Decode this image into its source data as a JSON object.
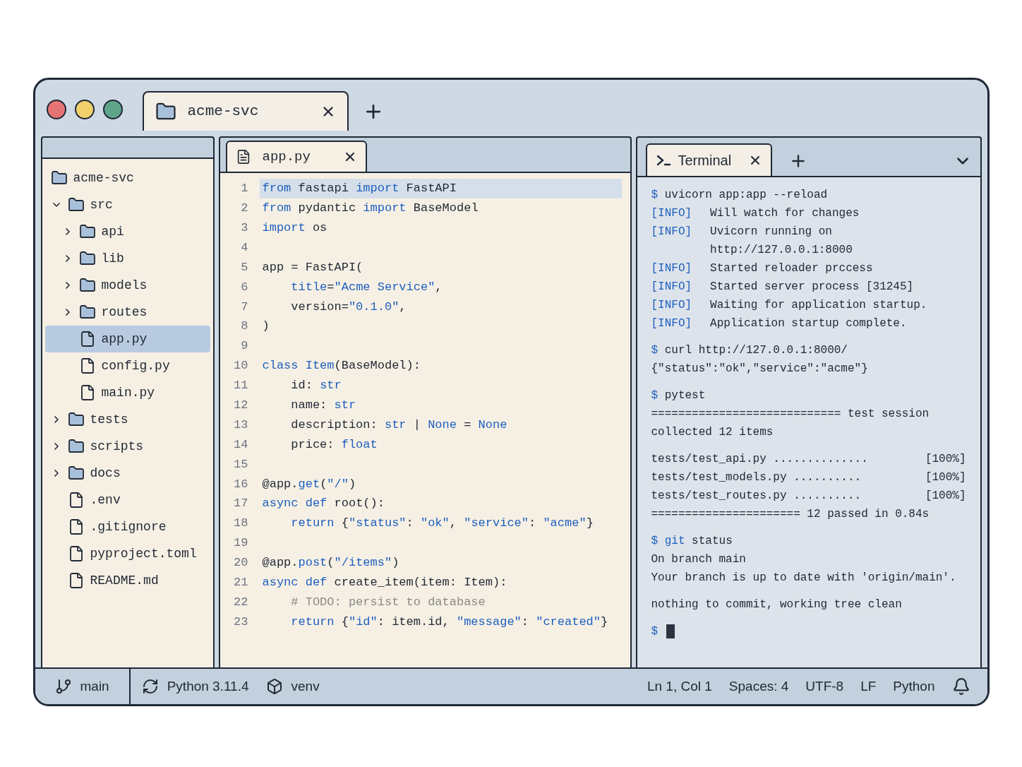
{
  "window": {
    "controls": [
      {
        "color": "#e57373"
      },
      {
        "color": "#f2d06b"
      },
      {
        "color": "#5fa58a"
      }
    ],
    "tabs": [
      {
        "label": "acme-svc",
        "selected": true
      }
    ]
  },
  "sidebar": {
    "tree": [
      {
        "label": "acme-svc",
        "kind": "folder",
        "selected": false,
        "children": [
          {
            "label": "src",
            "kind": "folder",
            "expanded": true,
            "selected": false,
            "children": [
              {
                "label": "api",
                "kind": "folder",
                "expanded": false,
                "selected": false
              },
              {
                "label": "lib",
                "kind": "folder",
                "expanded": false,
                "selected": false
              },
              {
                "label": "models",
                "kind": "folder",
                "expanded": false,
                "selected": false
              },
              {
                "label": "routes",
                "kind": "folder",
                "expanded": false,
                "selected": false
              },
              {
                "label": "app.py",
                "kind": "file",
                "selected": true
              },
              {
                "label": "config.py",
                "kind": "file",
                "selected": false
              },
              {
                "label": "main.py",
                "kind": "file",
                "selected": false
              }
            ]
          },
          {
            "label": "tests",
            "kind": "folder",
            "expanded": false,
            "selected": false
          },
          {
            "label": "scripts",
            "kind": "folder",
            "expanded": false,
            "selected": false
          },
          {
            "label": "docs",
            "kind": "folder",
            "expanded": false,
            "selected": false
          },
          {
            "label": ".env",
            "kind": "file",
            "selected": false
          },
          {
            "label": ".gitignore",
            "kind": "file",
            "selected": false
          },
          {
            "label": "pyproject.toml",
            "kind": "file",
            "selected": false
          },
          {
            "label": "README.md",
            "kind": "file",
            "selected": false
          }
        ]
      }
    ]
  },
  "editor": {
    "tabs": [
      {
        "label": "app.py",
        "selected": true
      }
    ],
    "lines": [
      {
        "number": "1",
        "highlighted": true,
        "segments": [
          {
            "kind": "keyword",
            "text": "from"
          },
          {
            "kind": "text",
            "text": " fastapi "
          },
          {
            "kind": "keyword",
            "text": "import"
          },
          {
            "kind": "text",
            "text": " FastAPI"
          }
        ]
      },
      {
        "number": "2",
        "highlighted": false,
        "segments": [
          {
            "kind": "keyword",
            "text": "from"
          },
          {
            "kind": "text",
            "text": " pydantic "
          },
          {
            "kind": "keyword",
            "text": "import"
          },
          {
            "kind": "text",
            "text": " BaseModel"
          }
        ]
      },
      {
        "number": "3",
        "highlighted": false,
        "segments": [
          {
            "kind": "keyword",
            "text": "import"
          },
          {
            "kind": "text",
            "text": " os"
          }
        ]
      },
      {
        "number": "4",
        "highlighted": false
      },
      {
        "number": "5",
        "highlighted": false,
        "segments": [
          {
            "kind": "text",
            "text": "app = FastAPI("
          }
        ]
      },
      {
        "number": "6",
        "highlighted": false,
        "segments": [
          {
            "kind": "keyword",
            "text": "    title"
          },
          {
            "kind": "text",
            "text": "="
          },
          {
            "kind": "keyword",
            "text": "\"Acme Service\""
          },
          {
            "kind": "text",
            "text": ","
          }
        ]
      },
      {
        "number": "7",
        "highlighted": false,
        "segments": [
          {
            "kind": "text",
            "text": "    version="
          },
          {
            "kind": "keyword",
            "text": "\"0.1.0\""
          },
          {
            "kind": "text",
            "text": ","
          }
        ]
      },
      {
        "number": "8",
        "highlighted": false,
        "segments": [
          {
            "kind": "text",
            "text": ")"
          }
        ]
      },
      {
        "number": "9",
        "highlighted": false
      },
      {
        "number": "10",
        "highlighted": false,
        "segments": [
          {
            "kind": "keyword",
            "text": "class Item"
          },
          {
            "kind": "text",
            "text": "(BaseModel):"
          }
        ]
      },
      {
        "number": "11",
        "highlighted": false,
        "segments": [
          {
            "kind": "text",
            "text": "    id: "
          },
          {
            "kind": "keyword",
            "text": "str"
          }
        ]
      },
      {
        "number": "12",
        "highlighted": false,
        "segments": [
          {
            "kind": "text",
            "text": "    name: "
          },
          {
            "kind": "keyword",
            "text": "str"
          }
        ]
      },
      {
        "number": "13",
        "highlighted": false,
        "segments": [
          {
            "kind": "text",
            "text": "    description: "
          },
          {
            "kind": "keyword",
            "text": "str"
          },
          {
            "kind": "text",
            "text": " | "
          },
          {
            "kind": "keyword",
            "text": "None"
          },
          {
            "kind": "text",
            "text": " = "
          },
          {
            "kind": "keyword",
            "text": "None"
          }
        ]
      },
      {
        "number": "14",
        "highlighted": false,
        "segments": [
          {
            "kind": "text",
            "text": "    price: "
          },
          {
            "kind": "keyword",
            "text": "float"
          }
        ]
      },
      {
        "number": "15",
        "highlighted": false
      },
      {
        "number": "16",
        "highlighted": false,
        "segments": [
          {
            "kind": "text",
            "text": "@app."
          },
          {
            "kind": "keyword",
            "text": "get"
          },
          {
            "kind": "text",
            "text": "("
          },
          {
            "kind": "keyword",
            "text": "\"/\""
          },
          {
            "kind": "text",
            "text": ")"
          }
        ]
      },
      {
        "number": "17",
        "highlighted": false,
        "segments": [
          {
            "kind": "keyword",
            "text": "async def"
          },
          {
            "kind": "text",
            "text": " root():"
          }
        ]
      },
      {
        "number": "18",
        "highlighted": false,
        "segments": [
          {
            "kind": "keyword",
            "text": "    return"
          },
          {
            "kind": "text",
            "text": " {"
          },
          {
            "kind": "keyword",
            "text": "\"status\""
          },
          {
            "kind": "text",
            "text": ": "
          },
          {
            "kind": "keyword",
            "text": "\"ok\""
          },
          {
            "kind": "text",
            "text": ", "
          },
          {
            "kind": "keyword",
            "text": "\"service\""
          },
          {
            "kind": "text",
            "text": ": "
          },
          {
            "kind": "keyword",
            "text": "\"acme\""
          },
          {
            "kind": "text",
            "text": "}"
          }
        ]
      },
      {
        "number": "19",
        "highlighted": false
      },
      {
        "number": "20",
        "highlighted": false,
        "segments": [
          {
            "kind": "text",
            "text": "@app."
          },
          {
            "kind": "keyword",
            "text": "post"
          },
          {
            "kind": "text",
            "text": "("
          },
          {
            "kind": "keyword",
            "text": "\"/items\""
          },
          {
            "kind": "text",
            "text": ")"
          }
        ]
      },
      {
        "number": "21",
        "highlighted": false,
        "segments": [
          {
            "kind": "keyword",
            "text": "async def"
          },
          {
            "kind": "text",
            "text": " create_item(item: Item):"
          }
        ]
      },
      {
        "number": "22",
        "highlighted": false,
        "segments": [
          {
            "kind": "comment",
            "text": "    # TODO: persist to database"
          }
        ]
      },
      {
        "number": "23",
        "highlighted": false,
        "segments": [
          {
            "kind": "keyword",
            "text": "    return"
          },
          {
            "kind": "text",
            "text": " {"
          },
          {
            "kind": "keyword",
            "text": "\"id\""
          },
          {
            "kind": "text",
            "text": ": item.id, "
          },
          {
            "kind": "keyword",
            "text": "\"message\""
          },
          {
            "kind": "text",
            "text": ": "
          },
          {
            "kind": "keyword",
            "text": "\"created\""
          },
          {
            "kind": "text",
            "text": "}"
          }
        ]
      }
    ]
  },
  "terminal": {
    "tabs": [
      {
        "label": "Terminal",
        "selected": true
      }
    ],
    "blocks": [
      [
        {
          "kind": "command",
          "segments": [
            {
              "kind": "keyword",
              "text": "$"
            },
            {
              "kind": "text",
              "text": " uvicorn app:app --reload"
            }
          ]
        },
        {
          "kind": "log",
          "tag": "[INFO]",
          "messages": [
            "Will watch for changes"
          ]
        },
        {
          "kind": "log",
          "tag": "[INFO]",
          "messages": [
            "Uvicorn running on",
            "http://127.0.0.1:8000"
          ]
        },
        {
          "kind": "log",
          "tag": "[INFO]",
          "messages": [
            "Started reloader prccess"
          ]
        },
        {
          "kind": "log",
          "tag": "[INFO]",
          "messages": [
            "Started server process [31245]"
          ]
        },
        {
          "kind": "log",
          "tag": "[INFO]",
          "messages": [
            "Waiting for application startup."
          ]
        },
        {
          "kind": "log",
          "tag": "[INFO]",
          "messages": [
            "Application startup complete."
          ]
        }
      ],
      [
        {
          "kind": "command",
          "segments": [
            {
              "kind": "keyword",
              "text": "$"
            },
            {
              "kind": "text",
              "text": " curl http://127.0.0.1:8000/"
            }
          ]
        },
        {
          "kind": "output",
          "segments": [
            {
              "kind": "text",
              "text": "{\"status\":\"ok\",\"service\":\"acme\"}"
            }
          ]
        }
      ],
      [
        {
          "kind": "command",
          "segments": [
            {
              "kind": "keyword",
              "text": "$"
            },
            {
              "kind": "text",
              "text": " pytest"
            }
          ]
        },
        {
          "kind": "output",
          "segments": [
            {
              "kind": "text",
              "text": "============================ test session"
            }
          ]
        },
        {
          "kind": "output",
          "segments": [
            {
              "kind": "text",
              "text": "collected 12 items"
            }
          ]
        }
      ],
      [
        {
          "kind": "result",
          "text": "tests/test_api.py ..............",
          "status": "[100%]"
        },
        {
          "kind": "result",
          "text": "tests/test_models.py ..........",
          "status": "[100%]"
        },
        {
          "kind": "result",
          "text": "tests/test_routes.py ..........",
          "status": "[100%]"
        },
        {
          "kind": "output",
          "segments": [
            {
              "kind": "text",
              "text": "====================== 12 passed in 0.84s"
            }
          ]
        }
      ],
      [
        {
          "kind": "command",
          "segments": [
            {
              "kind": "keyword",
              "text": "$ git"
            },
            {
              "kind": "text",
              "text": " status"
            }
          ]
        },
        {
          "kind": "output",
          "segments": [
            {
              "kind": "text",
              "text": "On branch main"
            }
          ]
        },
        {
          "kind": "output",
          "segments": [
            {
              "kind": "text",
              "text": "Your branch is up to date with 'origin/main'."
            }
          ]
        }
      ],
      [
        {
          "kind": "output",
          "segments": [
            {
              "kind": "text",
              "text": "nothing to commit, working tree clean"
            }
          ]
        }
      ],
      [
        {
          "kind": "prompt",
          "segments": [
            {
              "kind": "keyword",
              "text": "$"
            }
          ],
          "cursor": true
        }
      ]
    ]
  },
  "status_bar": {
    "left": [
      {
        "kind": "branch",
        "label": "main"
      },
      {
        "kind": "interpreter",
        "label": "Python 3.11.4"
      },
      {
        "kind": "environment",
        "label": "venv"
      }
    ],
    "right": [
      "Ln 1, Col 1",
      "Spaces: 4",
      "UTF-8",
      "LF",
      "Python"
    ]
  }
}
